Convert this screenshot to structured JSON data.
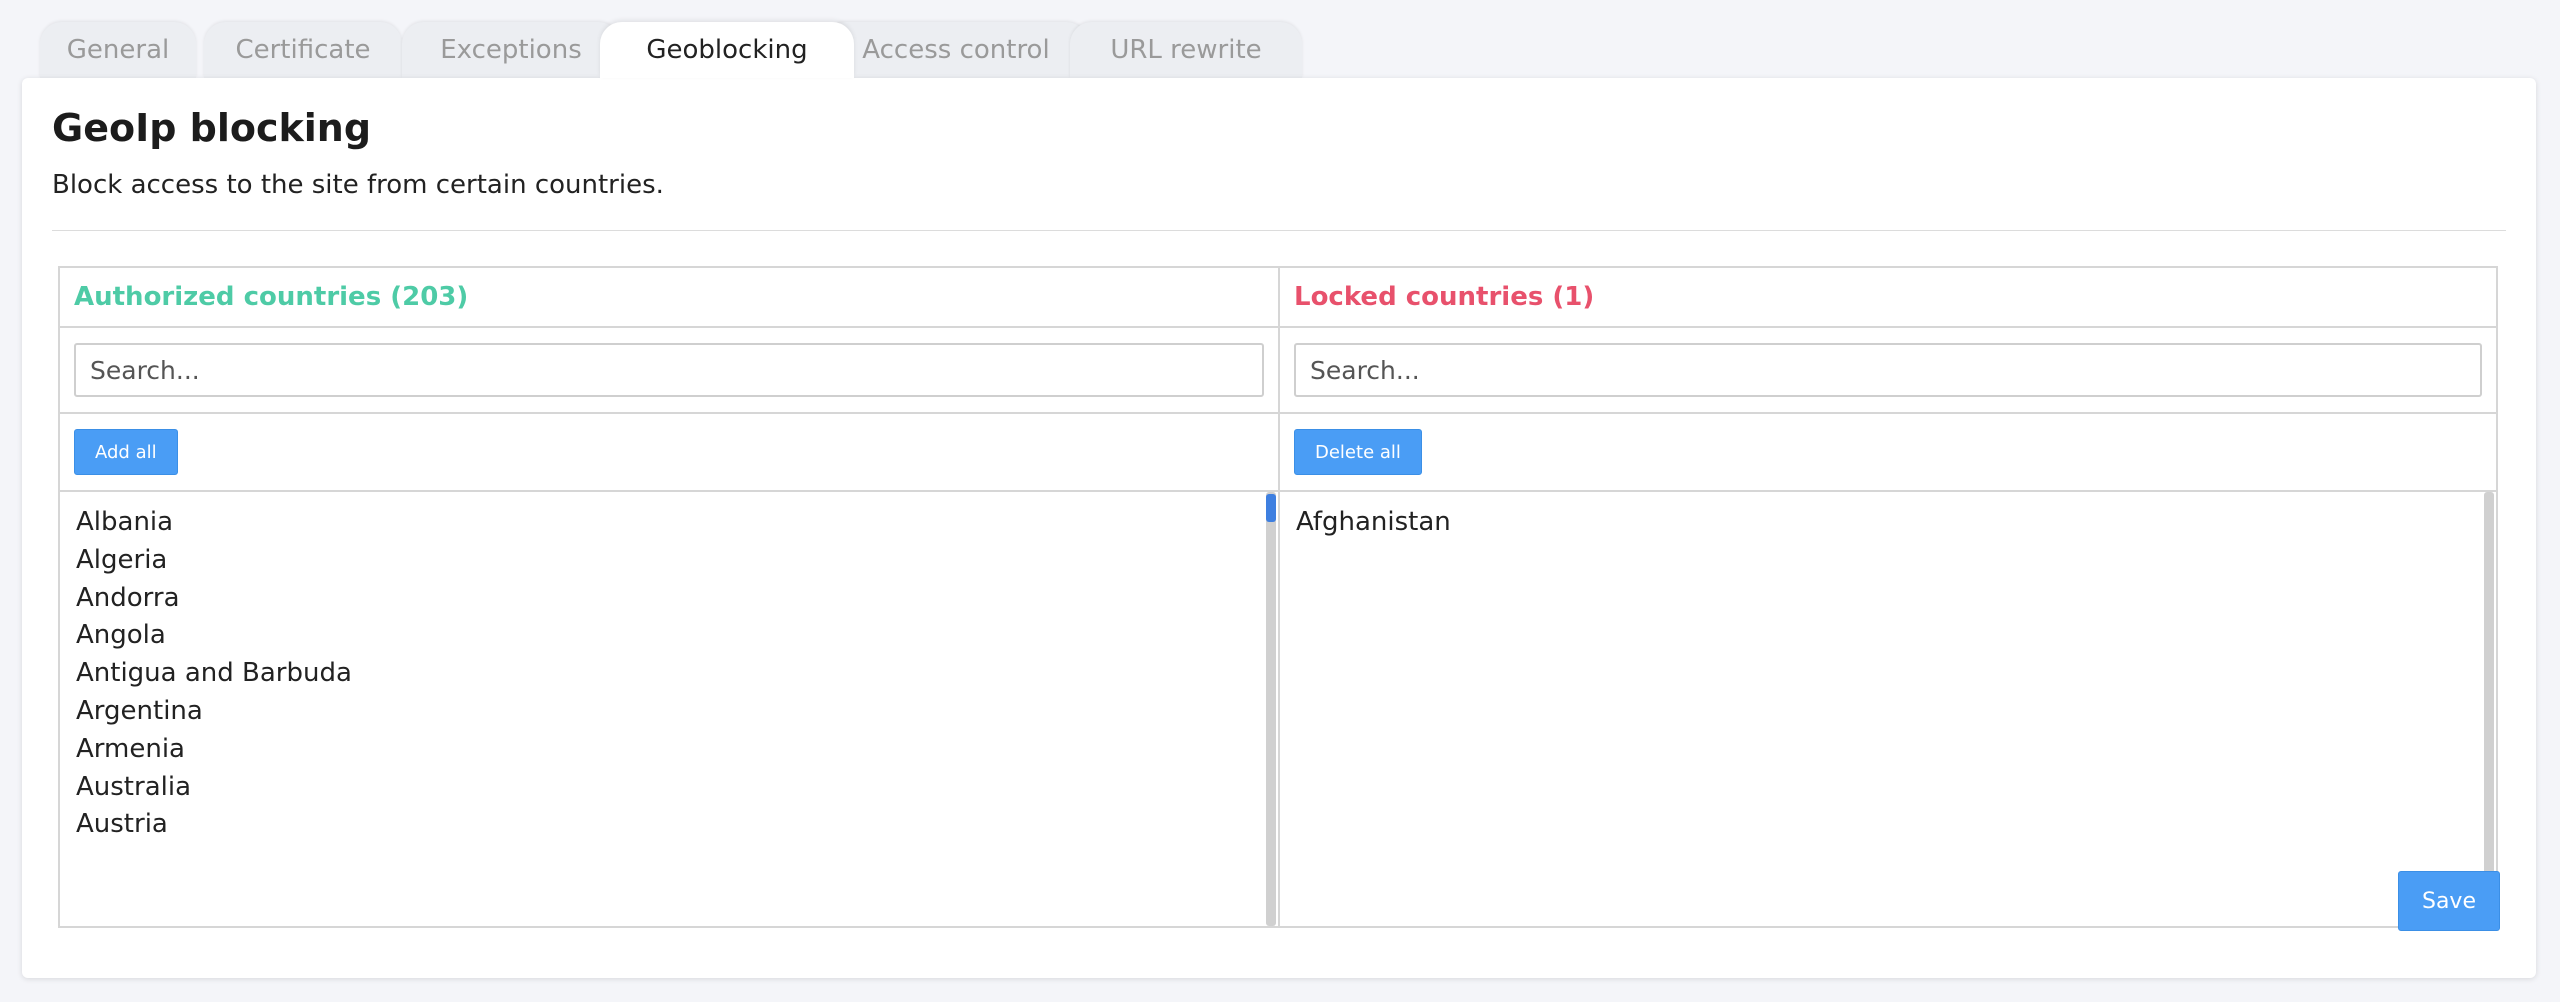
{
  "tabs": [
    {
      "label": "General"
    },
    {
      "label": "Certificate"
    },
    {
      "label": "Exceptions"
    },
    {
      "label": "Geoblocking"
    },
    {
      "label": "Access control"
    },
    {
      "label": "URL rewrite"
    }
  ],
  "active_tab": "Geoblocking",
  "page": {
    "title": "GeoIp blocking",
    "description": "Block access to the site from certain countries."
  },
  "authorized": {
    "heading": "Authorized countries (203)",
    "search_placeholder": "Search...",
    "button": "Add all",
    "countries": [
      "Albania",
      "Algeria",
      "Andorra",
      "Angola",
      "Antigua and Barbuda",
      "Argentina",
      "Armenia",
      "Australia",
      "Austria"
    ]
  },
  "locked": {
    "heading": "Locked countries (1)",
    "search_placeholder": "Search...",
    "button": "Delete all",
    "countries": [
      "Afghanistan"
    ]
  },
  "save_label": "Save",
  "colors": {
    "authorized_heading": "#4ecba6",
    "locked_heading": "#e8516c",
    "button": "#4a9df5",
    "scroll_thumb": "#3e7fe0"
  }
}
